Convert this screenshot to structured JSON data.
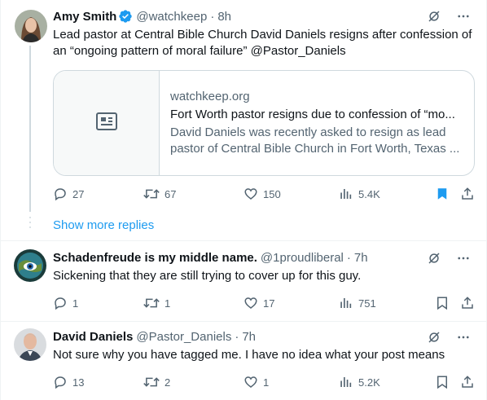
{
  "tweets": [
    {
      "name": "Amy Smith",
      "handle": "@watchkeep",
      "sep": "·",
      "time": "8h",
      "text": "Lead pastor at Central Bible Church David Daniels resigns after confession of an “ongoing pattern of moral failure” @Pastor_Daniels",
      "card": {
        "domain": "watchkeep.org",
        "title": "Fort Worth pastor resigns due to confession of “mo...",
        "description": "David Daniels was recently asked to resign as lead pastor of Central Bible Church in Fort Worth, Texas ..."
      },
      "replies": "27",
      "reposts": "67",
      "likes": "150",
      "views": "5.4K"
    },
    {
      "name": "Schadenfreude is my middle name.",
      "handle": "@1proudliberal",
      "sep": "·",
      "time": "7h",
      "text": "Sickening that they are still trying to cover up for this guy.",
      "replies": "1",
      "reposts": "1",
      "likes": "17",
      "views": "751"
    },
    {
      "name": "David Daniels",
      "handle": "@Pastor_Daniels",
      "sep": "·",
      "time": "7h",
      "text": "Not sure why you have tagged me. I have no idea what your post means",
      "replies": "13",
      "reposts": "2",
      "likes": "1",
      "views": "5.2K"
    }
  ],
  "show_more_replies": "Show more replies",
  "colors": {
    "accent": "#1d9bf0",
    "secondary_text": "#536471",
    "border": "#cfd9de"
  },
  "icons": [
    "verified-badge-icon",
    "grok-icon",
    "more-icon",
    "article-icon",
    "reply-icon",
    "repost-icon",
    "like-icon",
    "views-icon",
    "bookmark-icon",
    "share-icon"
  ]
}
